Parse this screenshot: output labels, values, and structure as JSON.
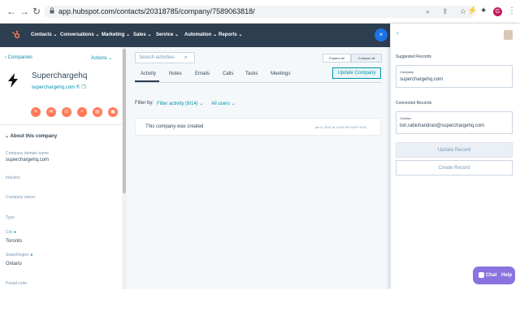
{
  "browser": {
    "url": "app.hubspot.com/contacts/20318785/company/7589063818/"
  },
  "nav": {
    "items": [
      "Contacts",
      "Conversations",
      "Marketing",
      "Sales",
      "Service",
      "Automation",
      "Reports"
    ]
  },
  "left": {
    "back_label": "Companies",
    "actions_label": "Actions",
    "company_name": "Superchargehq",
    "company_domain": "superchargehq.com",
    "about_title": "About this company",
    "fields": [
      {
        "label": "Company domain name",
        "value": "superchargehq.com"
      },
      {
        "label": "Industry",
        "value": ""
      },
      {
        "label": "Company owner",
        "value": ""
      },
      {
        "label": "Type",
        "value": ""
      },
      {
        "label": "City",
        "value": "Toronto"
      },
      {
        "label": "State/Region",
        "value": "Ontario"
      },
      {
        "label": "Postal code",
        "value": ""
      }
    ]
  },
  "middle": {
    "search_placeholder": "Search activities",
    "expand_label": "Expand all",
    "collapse_label": "Collapse all",
    "tabs": [
      "Activity",
      "Notes",
      "Emails",
      "Calls",
      "Tasks",
      "Meetings"
    ],
    "update_company_label": "Update Company",
    "filter_by_label": "Filter by:",
    "filter_activity_label": "Filter activity (9/14)",
    "all_users_label": "All users",
    "activity": {
      "text": "This company was created",
      "date": "Jan 6, 2022 at 10:05 PM GMT+5:30"
    }
  },
  "right": {
    "suggested_title": "Suggested Records",
    "company_label": "Company",
    "company_value": "superchargehq.com",
    "connected_title": "Connected Records",
    "contact_label": "Contact",
    "contact_value": "tori.rabichandran@superchargehq.com",
    "update_record_label": "Update Record",
    "create_record_label": "Create Record"
  },
  "chat": {
    "chat_label": "Chat",
    "help_label": "Help"
  },
  "colors": {
    "nav_bg": "#2d3e50",
    "accent_orange": "#ff7a59",
    "link_teal": "#0091ae",
    "chat_purple": "#8b73df"
  }
}
